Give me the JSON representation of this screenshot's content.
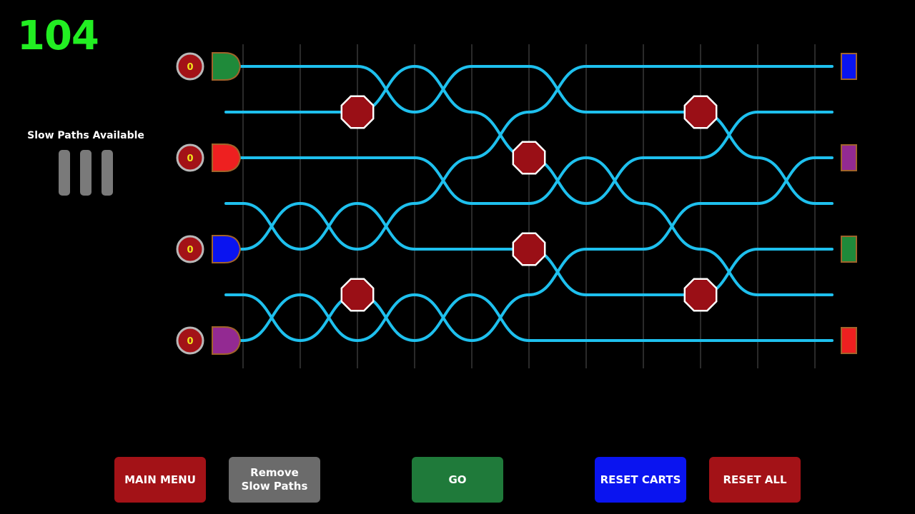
{
  "score": "104",
  "slow_paths": {
    "label": "Slow Paths Available",
    "available": 3,
    "bar_color": "#7a7a7a"
  },
  "colors": {
    "track": "#1ec0ee",
    "gridline": "#555555",
    "stop": "#9a0f16",
    "stop_border": "#ffffff",
    "counter_bg": "#a31217",
    "counter_ring": "#b8b8b8",
    "counter_text": "#f2e51b",
    "cart_border": "#a0632a"
  },
  "carts": [
    {
      "color": "#1f8a3a",
      "count": "0",
      "icon": "cart-green-icon"
    },
    {
      "color": "#ee2020",
      "count": "0",
      "icon": "cart-red-icon"
    },
    {
      "color": "#0a14f0",
      "count": "0",
      "icon": "cart-blue-icon"
    },
    {
      "color": "#932a92",
      "count": "0",
      "icon": "cart-purple-icon"
    }
  ],
  "destinations": [
    {
      "color": "#0a14f0",
      "icon": "destination-blue-icon"
    },
    {
      "color": "#932a92",
      "icon": "destination-purple-icon"
    },
    {
      "color": "#1f8a3a",
      "icon": "destination-green-icon"
    },
    {
      "color": "#ee2020",
      "icon": "destination-red-icon"
    }
  ],
  "board": {
    "lanes": 7,
    "columns": 10,
    "swaps": [
      {
        "col": 2,
        "lane": 0
      },
      {
        "col": 3,
        "lane": 0
      },
      {
        "col": 5,
        "lane": 0
      },
      {
        "col": 4,
        "lane": 1
      },
      {
        "col": 8,
        "lane": 1
      },
      {
        "col": 3,
        "lane": 2
      },
      {
        "col": 5,
        "lane": 2
      },
      {
        "col": 6,
        "lane": 2
      },
      {
        "col": 9,
        "lane": 2
      },
      {
        "col": 0,
        "lane": 3
      },
      {
        "col": 1,
        "lane": 3
      },
      {
        "col": 2,
        "lane": 3
      },
      {
        "col": 7,
        "lane": 3
      },
      {
        "col": 10,
        "lane": 3
      },
      {
        "col": 5,
        "lane": 4
      },
      {
        "col": 8,
        "lane": 4
      },
      {
        "col": 0,
        "lane": 5
      },
      {
        "col": 1,
        "lane": 5
      },
      {
        "col": 2,
        "lane": 5
      },
      {
        "col": 3,
        "lane": 5
      },
      {
        "col": 4,
        "lane": 5
      },
      {
        "col": 10,
        "lane": 5
      }
    ],
    "stops": [
      {
        "node": 2,
        "lane": 1
      },
      {
        "node": 8,
        "lane": 1
      },
      {
        "node": 5,
        "lane": 2
      },
      {
        "node": 5,
        "lane": 4
      },
      {
        "node": 2,
        "lane": 5
      },
      {
        "node": 8,
        "lane": 5
      }
    ]
  },
  "buttons": {
    "main_menu": {
      "label": "MAIN MENU",
      "color": "#a31217"
    },
    "remove_slow": {
      "label": "Remove\nSlow Paths",
      "color": "#6b6b6b"
    },
    "go": {
      "label": "GO",
      "color": "#1f7a3a"
    },
    "reset_carts": {
      "label": "RESET CARTS",
      "color": "#0a14f0"
    },
    "reset_all": {
      "label": "RESET ALL",
      "color": "#a31217"
    }
  }
}
